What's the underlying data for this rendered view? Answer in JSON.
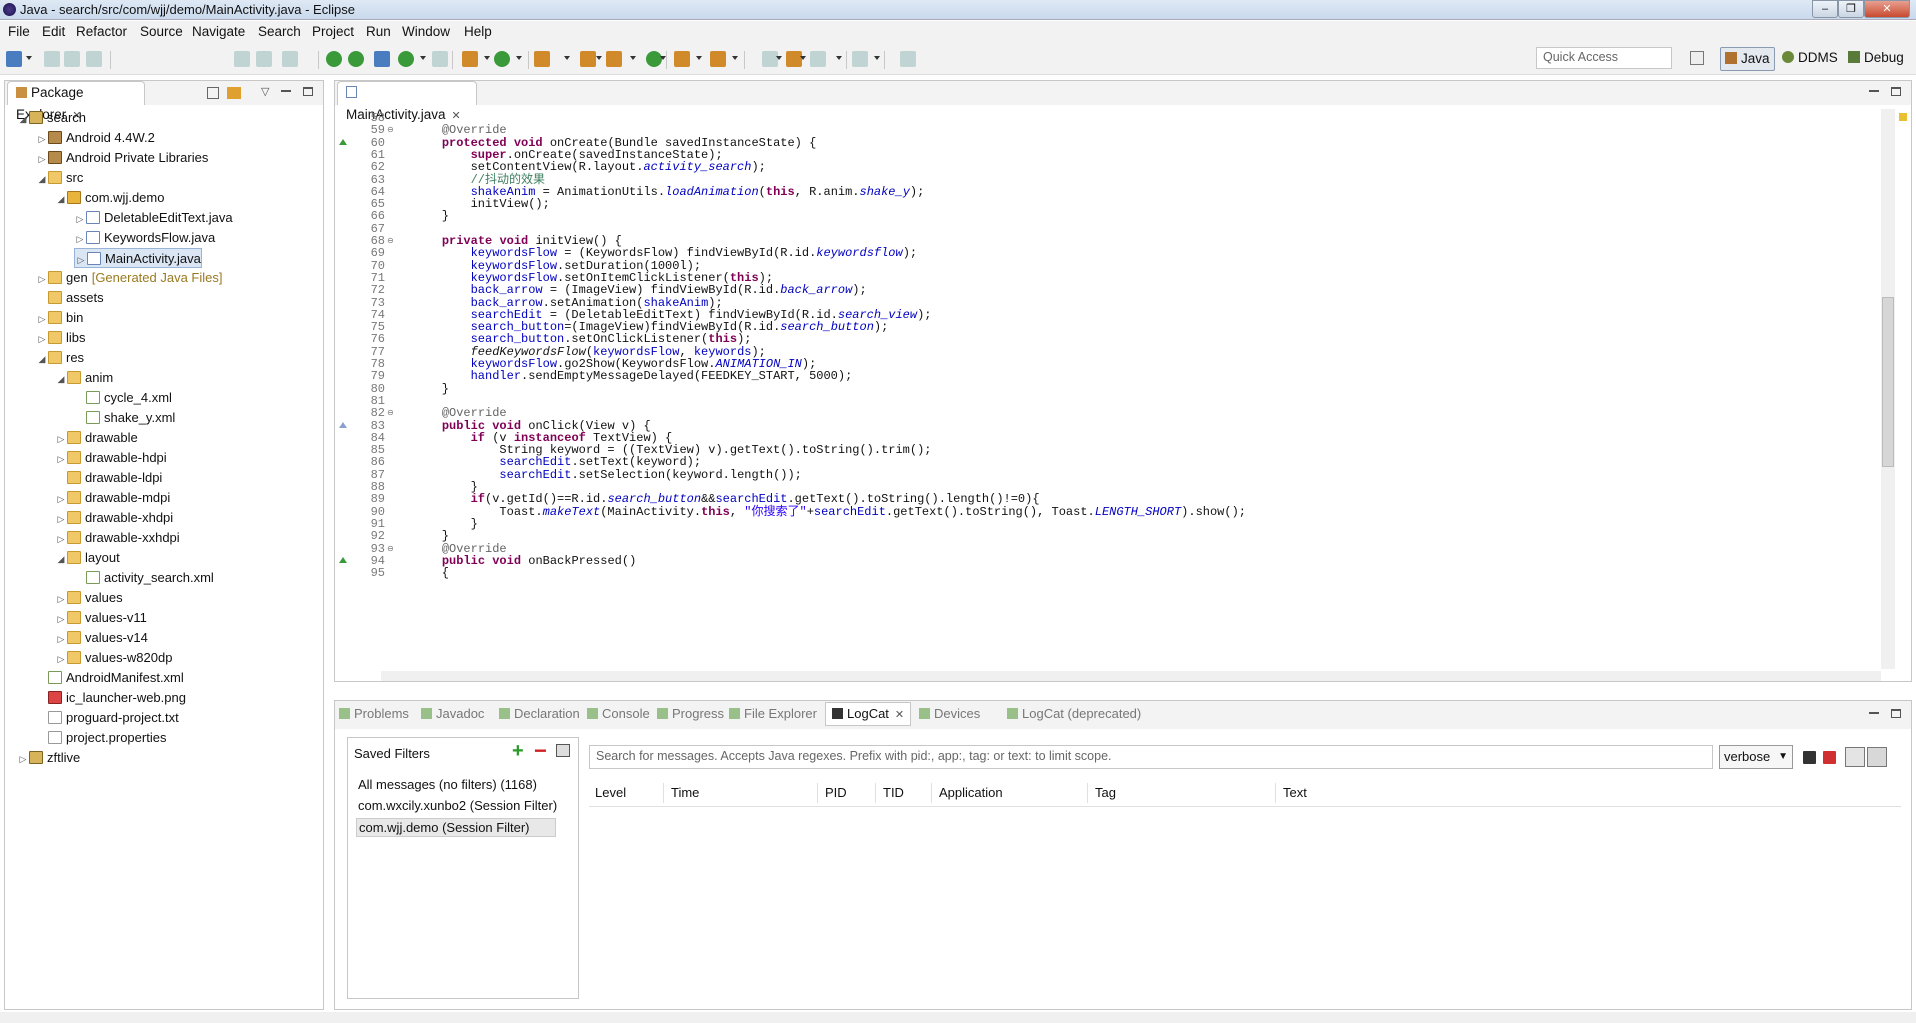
{
  "window": {
    "title": "Java - search/src/com/wjj/demo/MainActivity.java - Eclipse",
    "controls": [
      "–",
      "❐",
      "✕"
    ]
  },
  "menu": [
    "File",
    "Edit",
    "Refactor",
    "Source",
    "Navigate",
    "Search",
    "Project",
    "Run",
    "Window",
    "Help"
  ],
  "toolbar": {
    "quick_access_placeholder": "Quick Access",
    "perspectives": [
      "Java",
      "DDMS",
      "Debug"
    ]
  },
  "package_explorer": {
    "tab_label": "Package Explorer",
    "tree": [
      {
        "label": "search",
        "depth": 0,
        "arrow": "expanded",
        "icon": "project-icon"
      },
      {
        "label": "Android 4.4W.2",
        "depth": 1,
        "arrow": "collapsed",
        "icon": "library-icon"
      },
      {
        "label": "Android Private Libraries",
        "depth": 1,
        "arrow": "collapsed",
        "icon": "library-icon"
      },
      {
        "label": "src",
        "depth": 1,
        "arrow": "expanded",
        "icon": "source-folder-icon"
      },
      {
        "label": "com.wjj.demo",
        "depth": 2,
        "arrow": "expanded",
        "icon": "package-icon"
      },
      {
        "label": "DeletableEditText.java",
        "depth": 3,
        "arrow": "collapsed",
        "icon": "java-file-icon"
      },
      {
        "label": "KeywordsFlow.java",
        "depth": 3,
        "arrow": "collapsed",
        "icon": "java-file-icon"
      },
      {
        "label": "MainActivity.java",
        "depth": 3,
        "arrow": "collapsed",
        "icon": "java-file-icon",
        "selected": true
      },
      {
        "label": "gen",
        "suffix": "[Generated Java Files]",
        "depth": 1,
        "arrow": "collapsed",
        "icon": "source-folder-icon"
      },
      {
        "label": "assets",
        "depth": 1,
        "arrow": "",
        "icon": "folder-icon"
      },
      {
        "label": "bin",
        "depth": 1,
        "arrow": "collapsed",
        "icon": "folder-icon"
      },
      {
        "label": "libs",
        "depth": 1,
        "arrow": "collapsed",
        "icon": "folder-icon"
      },
      {
        "label": "res",
        "depth": 1,
        "arrow": "expanded",
        "icon": "folder-icon"
      },
      {
        "label": "anim",
        "depth": 2,
        "arrow": "expanded",
        "icon": "folder-icon"
      },
      {
        "label": "cycle_4.xml",
        "depth": 3,
        "arrow": "",
        "icon": "xml-file-icon"
      },
      {
        "label": "shake_y.xml",
        "depth": 3,
        "arrow": "",
        "icon": "xml-file-icon"
      },
      {
        "label": "drawable",
        "depth": 2,
        "arrow": "collapsed",
        "icon": "folder-icon"
      },
      {
        "label": "drawable-hdpi",
        "depth": 2,
        "arrow": "collapsed",
        "icon": "folder-icon"
      },
      {
        "label": "drawable-ldpi",
        "depth": 2,
        "arrow": "",
        "icon": "folder-icon"
      },
      {
        "label": "drawable-mdpi",
        "depth": 2,
        "arrow": "collapsed",
        "icon": "folder-icon"
      },
      {
        "label": "drawable-xhdpi",
        "depth": 2,
        "arrow": "collapsed",
        "icon": "folder-icon"
      },
      {
        "label": "drawable-xxhdpi",
        "depth": 2,
        "arrow": "collapsed",
        "icon": "folder-icon"
      },
      {
        "label": "layout",
        "depth": 2,
        "arrow": "expanded",
        "icon": "folder-icon"
      },
      {
        "label": "activity_search.xml",
        "depth": 3,
        "arrow": "",
        "icon": "xml-file-icon"
      },
      {
        "label": "values",
        "depth": 2,
        "arrow": "collapsed",
        "icon": "folder-icon"
      },
      {
        "label": "values-v11",
        "depth": 2,
        "arrow": "collapsed",
        "icon": "folder-icon"
      },
      {
        "label": "values-v14",
        "depth": 2,
        "arrow": "collapsed",
        "icon": "folder-icon"
      },
      {
        "label": "values-w820dp",
        "depth": 2,
        "arrow": "collapsed",
        "icon": "folder-icon"
      },
      {
        "label": "AndroidManifest.xml",
        "depth": 1,
        "arrow": "",
        "icon": "xml-file-icon"
      },
      {
        "label": "ic_launcher-web.png",
        "depth": 1,
        "arrow": "",
        "icon": "image-file-icon"
      },
      {
        "label": "proguard-project.txt",
        "depth": 1,
        "arrow": "",
        "icon": "text-file-icon"
      },
      {
        "label": "project.properties",
        "depth": 1,
        "arrow": "",
        "icon": "text-file-icon"
      },
      {
        "label": "zftlive",
        "depth": 0,
        "arrow": "collapsed",
        "icon": "project-icon"
      }
    ]
  },
  "editor": {
    "tab_label": "MainActivity.java",
    "lines": [
      {
        "n": "58",
        "t": ""
      },
      {
        "n": "59",
        "t": "    @Override",
        "fold": true
      },
      {
        "n": "60",
        "t": "    protected void onCreate(Bundle savedInstanceState) {",
        "mark": true
      },
      {
        "n": "61",
        "t": "        super.onCreate(savedInstanceState);"
      },
      {
        "n": "62",
        "t": "        setContentView(R.layout.activity_search);"
      },
      {
        "n": "63",
        "t": "        //抖动的效果"
      },
      {
        "n": "64",
        "t": "        shakeAnim = AnimationUtils.loadAnimation(this, R.anim.shake_y);"
      },
      {
        "n": "65",
        "t": "        initView();"
      },
      {
        "n": "66",
        "t": "    }"
      },
      {
        "n": "67",
        "t": ""
      },
      {
        "n": "68",
        "t": "    private void initView() {",
        "fold": true
      },
      {
        "n": "69",
        "t": "        keywordsFlow = (KeywordsFlow) findViewById(R.id.keywordsflow);"
      },
      {
        "n": "70",
        "t": "        keywordsFlow.setDuration(1000l);"
      },
      {
        "n": "71",
        "t": "        keywordsFlow.setOnItemClickListener(this);"
      },
      {
        "n": "72",
        "t": "        back_arrow = (ImageView) findViewById(R.id.back_arrow);"
      },
      {
        "n": "73",
        "t": "        back_arrow.setAnimation(shakeAnim);"
      },
      {
        "n": "74",
        "t": "        searchEdit = (DeletableEditText) findViewById(R.id.search_view);"
      },
      {
        "n": "75",
        "t": "        search_button=(ImageView)findViewById(R.id.search_button);"
      },
      {
        "n": "76",
        "t": "        search_button.setOnClickListener(this);"
      },
      {
        "n": "77",
        "t": "        feedKeywordsFlow(keywordsFlow, keywords);"
      },
      {
        "n": "78",
        "t": "        keywordsFlow.go2Show(KeywordsFlow.ANIMATION_IN);"
      },
      {
        "n": "79",
        "t": "        handler.sendEmptyMessageDelayed(FEEDKEY_START, 5000);"
      },
      {
        "n": "80",
        "t": "    }"
      },
      {
        "n": "81",
        "t": ""
      },
      {
        "n": "82",
        "t": "    @Override",
        "fold": true
      },
      {
        "n": "83",
        "t": "    public void onClick(View v) {",
        "mark": "impl"
      },
      {
        "n": "84",
        "t": "        if (v instanceof TextView) {"
      },
      {
        "n": "85",
        "t": "            String keyword = ((TextView) v).getText().toString().trim();"
      },
      {
        "n": "86",
        "t": "            searchEdit.setText(keyword);"
      },
      {
        "n": "87",
        "t": "            searchEdit.setSelection(keyword.length());"
      },
      {
        "n": "88",
        "t": "        }"
      },
      {
        "n": "89",
        "t": "        if(v.getId()==R.id.search_button&&searchEdit.getText().toString().length()!=0){"
      },
      {
        "n": "90",
        "t": "            Toast.makeText(MainActivity.this, \"你搜索了\"+searchEdit.getText().toString(), Toast.LENGTH_SHORT).show();"
      },
      {
        "n": "91",
        "t": "        }"
      },
      {
        "n": "92",
        "t": "    }"
      },
      {
        "n": "93",
        "t": "    @Override",
        "fold": true
      },
      {
        "n": "94",
        "t": "    public void onBackPressed()",
        "mark": true
      },
      {
        "n": "95",
        "t": "    {"
      }
    ]
  },
  "bottom_tabs": [
    "Problems",
    "Javadoc",
    "Declaration",
    "Console",
    "Progress",
    "File Explorer",
    "LogCat",
    "Devices",
    "LogCat (deprecated)"
  ],
  "logcat": {
    "saved_filters_label": "Saved Filters",
    "filters": [
      "All messages (no filters) (1168)",
      "com.wxcily.xunbo2 (Session Filter)",
      "com.wjj.demo (Session Filter)"
    ],
    "search_placeholder": "Search for messages. Accepts Java regexes. Prefix with pid:, app:, tag: or text: to limit scope.",
    "level_select": "verbose",
    "columns": [
      "Level",
      "Time",
      "PID",
      "TID",
      "Application",
      "Tag",
      "Text"
    ]
  },
  "colors": {
    "keyword": "#7f0055",
    "field": "#0000c0",
    "comment": "#3f7f5f",
    "string": "#2a00ff",
    "annotation": "#646464",
    "selection": "#dbe6f4"
  }
}
